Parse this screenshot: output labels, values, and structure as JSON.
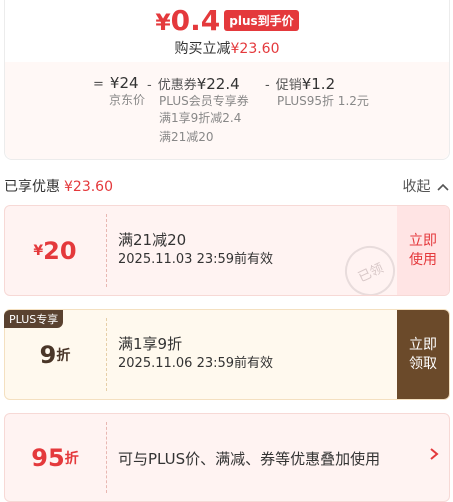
{
  "header": {
    "price_yen": "¥",
    "price_value": "0.4",
    "plus_tag": "plus到手价",
    "reduce_label": "购买立减",
    "reduce_amount": "¥23.60"
  },
  "breakdown": [
    {
      "op": "=",
      "amount": "¥24",
      "label": "",
      "subs": [
        "京东价"
      ]
    },
    {
      "op": "-",
      "amount": "¥22.4",
      "label": "优惠券",
      "subs": [
        "PLUS会员专享券",
        "满1享9折减2.4",
        "满21减20"
      ]
    },
    {
      "op": "-",
      "amount": "¥1.2",
      "label": "促销",
      "subs": [
        "PLUS95折 1.2元"
      ]
    }
  ],
  "enjoyed": {
    "label": "已享优惠",
    "amount": "¥23.60",
    "collapse": "收起"
  },
  "coupons": [
    {
      "value_prefix": "¥",
      "value": "20",
      "value_suffix": "",
      "title": "满21减20",
      "date": "2025.11.03 23:59前有效",
      "button": "立即使用",
      "button_l1": "立即",
      "button_l2": "使用",
      "stamp": "已领"
    },
    {
      "badge": "PLUS专享",
      "value_prefix": "",
      "value": "9",
      "value_suffix": "折",
      "title": "满1享9折",
      "date": "2025.11.06 23:59前有效",
      "button": "立即领取",
      "button_l1": "立即",
      "button_l2": "领取"
    },
    {
      "value_prefix": "",
      "value": "95",
      "value_suffix": "折",
      "title": "可与PLUS价、满减、券等优惠叠加使用"
    }
  ],
  "icons": {
    "chevron_up": "chevron-up-icon",
    "chevron_right": "chevron-right-icon"
  },
  "colors": {
    "accent": "#e4393c",
    "plus_brown": "#6b4a2a",
    "card_pink": "#fff3f2",
    "card_cream": "#fff9ee"
  }
}
